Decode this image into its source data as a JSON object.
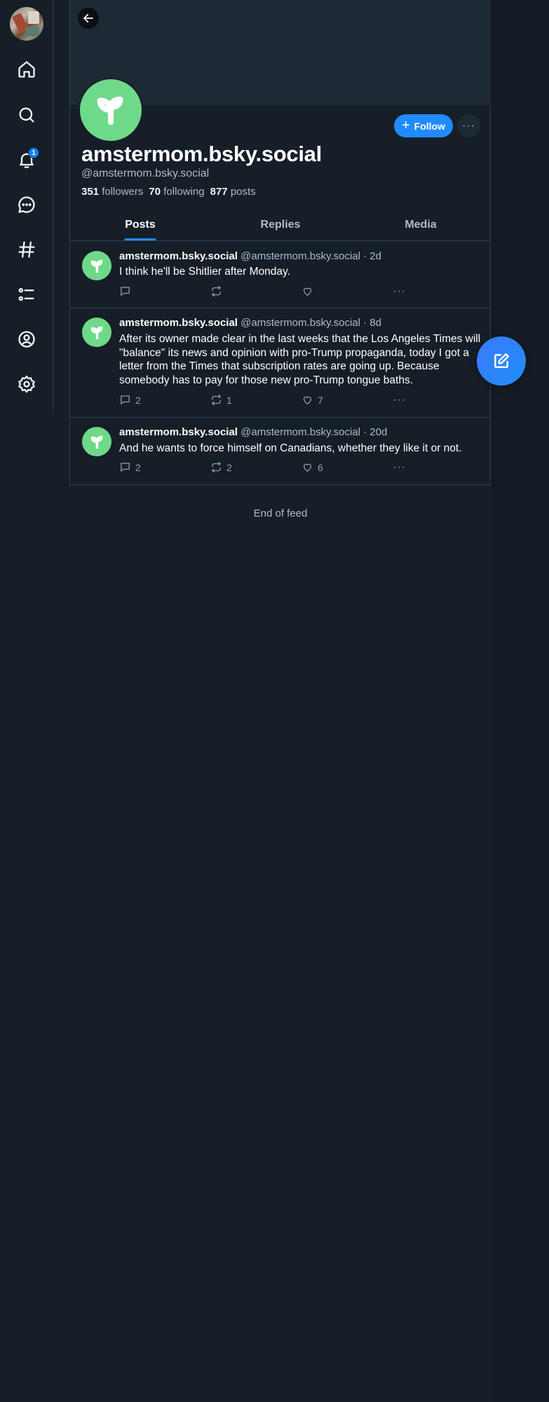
{
  "colors": {
    "background": "#161e27",
    "accent": "#208bfe",
    "avatar_green": "#6fd98a",
    "muted_text": "#aebbc9"
  },
  "sidebar": {
    "notification_badge": "1",
    "items": [
      {
        "icon": "home-icon"
      },
      {
        "icon": "search-icon"
      },
      {
        "icon": "bell-icon"
      },
      {
        "icon": "chat-icon"
      },
      {
        "icon": "hashtag-icon"
      },
      {
        "icon": "list-icon"
      },
      {
        "icon": "profile-icon"
      },
      {
        "icon": "gear-icon"
      }
    ]
  },
  "profile": {
    "display_name": "amstermom.bsky.social",
    "handle": "@amstermom.bsky.social",
    "follow_label": "Follow",
    "more_label": "···",
    "stats": {
      "followers_count": "351",
      "followers_label": "followers",
      "following_count": "70",
      "following_label": "following",
      "posts_count": "877",
      "posts_label": "posts"
    }
  },
  "tabs": [
    {
      "label": "Posts",
      "active": true
    },
    {
      "label": "Replies",
      "active": false
    },
    {
      "label": "Media",
      "active": false
    }
  ],
  "posts": [
    {
      "author": "amstermom.bsky.social",
      "handle_time": "@amstermom.bsky.social · 2d",
      "text": "I think he'll be Shitlier after Monday.",
      "replies": "",
      "reposts": "",
      "likes": ""
    },
    {
      "author": "amstermom.bsky.social",
      "handle_time": "@amstermom.bsky.social · 8d",
      "text": "After its owner made clear in the last weeks that the Los Angeles Times will \"balance\" its news and opinion with pro-Trump propaganda, today I got a letter from the Times that subscription rates are going up. Because somebody has to pay for those new pro-Trump tongue baths.",
      "replies": "2",
      "reposts": "1",
      "likes": "7"
    },
    {
      "author": "amstermom.bsky.social",
      "handle_time": "@amstermom.bsky.social · 20d",
      "text": "And he wants to force himself on Canadians, whether they like it or not.",
      "replies": "2",
      "reposts": "2",
      "likes": "6"
    }
  ],
  "feed": {
    "end_label": "End of feed",
    "more_dots": "···"
  }
}
